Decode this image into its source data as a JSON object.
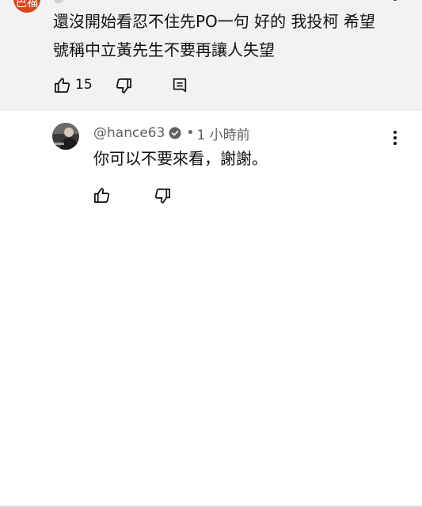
{
  "parent_comment": {
    "avatar_text": "巴福",
    "text_line1": "還沒開始看忍不住先PO一句 好的 我投柯 希望",
    "text_line2": "號稱中立黃先生不要再讓人失望",
    "like_count": "15",
    "icons": [
      "thumbs-up-icon",
      "thumbs-down-icon",
      "reply-comment-icon",
      "more-vert-icon"
    ]
  },
  "reply": {
    "handle": "@hance63",
    "separator": "•",
    "time": "1 小時前",
    "text": "你可以不要來看，謝謝。",
    "icons": [
      "verified-icon",
      "thumbs-up-icon",
      "thumbs-down-icon",
      "more-vert-icon"
    ]
  },
  "colors": {
    "parent_background": "#f2f2f2",
    "page_background": "#ffffff",
    "text_primary": "#0f0f0f",
    "text_secondary": "#606060",
    "avatar_accent": "#d9461e"
  }
}
